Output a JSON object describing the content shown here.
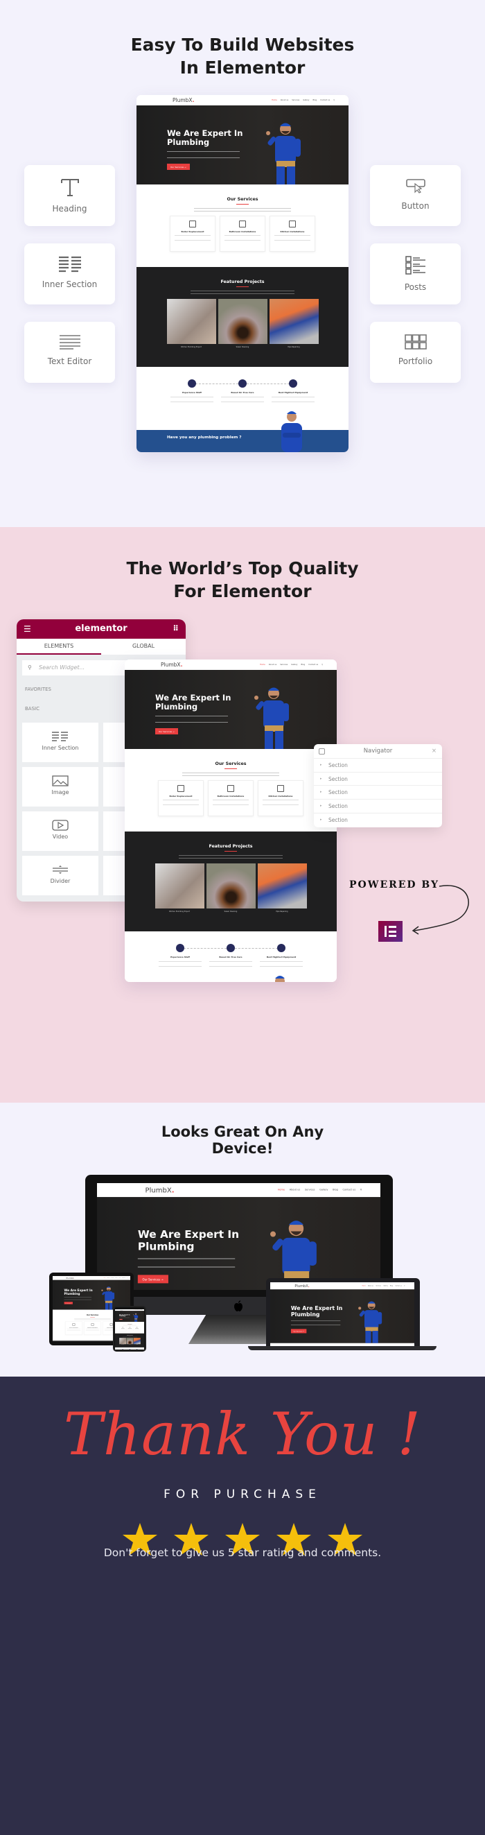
{
  "section1": {
    "title_line1": "Easy To Build Websites",
    "title_line2": "In Elementor",
    "widgets_left": [
      {
        "label": "Heading",
        "icon": "heading-icon"
      },
      {
        "label": "Inner Section",
        "icon": "inner-section-icon"
      },
      {
        "label": "Text Editor",
        "icon": "text-editor-icon"
      }
    ],
    "widgets_right": [
      {
        "label": "Button",
        "icon": "button-icon"
      },
      {
        "label": "Posts",
        "icon": "posts-icon"
      },
      {
        "label": "Portfolio",
        "icon": "portfolio-icon"
      }
    ]
  },
  "site": {
    "logo": "PlumbX",
    "logo_dot": ".",
    "nav": [
      "Home",
      "About us",
      "Services",
      "Gallery",
      "Blog",
      "Contact us"
    ],
    "hero_title": "We Are Expert In Plumbing",
    "hero_button": "Our Services →",
    "services_title": "Our Services",
    "services": [
      "Boiler Replacement",
      "Bathroom Installations",
      "Kitchen Installations"
    ],
    "projects_title": "Featured Projects",
    "projects": [
      "Kitchen Plumbing Project",
      "Sewer Cleaning",
      "Pipe Repairing"
    ],
    "features": [
      "Experience Staff",
      "Based On True Care",
      "Best Hightect Equipment"
    ],
    "cta": "Have you any plumbing problem ?"
  },
  "section2": {
    "title_line1": "The World’s Top Quality",
    "title_line2": "For Elementor",
    "panel": {
      "brand": "elementor",
      "tabs": [
        "ELEMENTS",
        "GLOBAL"
      ],
      "search_placeholder": "Search Widget...",
      "favorites": "FAVORITES",
      "basic": "BASIC",
      "tiles": [
        "Inner Section",
        "Image",
        "Video",
        "Divider"
      ]
    },
    "navigator": {
      "title": "Navigator",
      "rows": [
        "Section",
        "Section",
        "Section",
        "Section",
        "Section"
      ]
    },
    "powered_by": "POWERED BY"
  },
  "section3": {
    "title_line1": "Looks Great On Any",
    "title_line2": "Device!"
  },
  "section4": {
    "thank_you": "Thank You !",
    "for_purchase": "FOR PURCHASE",
    "rating": 5,
    "note": "Don't forget to give us 5 star rating and comments."
  },
  "colors": {
    "accent_red": "#e83f3f",
    "elementor": "#92003b",
    "dark_bg": "#2f2e48",
    "pink_bg": "#f3d9e2",
    "star": "#f5bf0c",
    "cta_blue": "#24508e"
  }
}
